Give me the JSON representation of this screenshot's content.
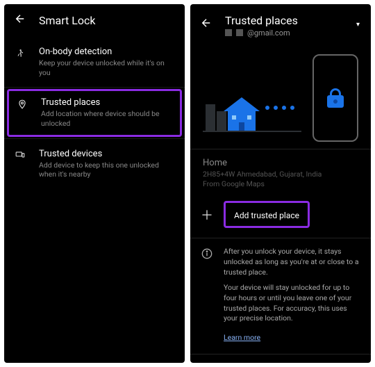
{
  "left": {
    "title": "Smart Lock",
    "items": [
      {
        "title": "On-body detection",
        "subtitle": "Keep your device unlocked while it's on you"
      },
      {
        "title": "Trusted places",
        "subtitle": "Add location where device should be unlocked"
      },
      {
        "title": "Trusted devices",
        "subtitle": "Add device to keep this one unlocked when it's nearby"
      }
    ]
  },
  "right": {
    "title": "Trusted places",
    "account": "@gmail.com",
    "home": {
      "label": "Home",
      "address": "2H85+4W Ahmedabad, Gujarat, India",
      "source": "From Google Maps"
    },
    "add_label": "Add trusted place",
    "info": {
      "p1": "After you unlock your device, it stays unlocked as long as you're at or close to a trusted place.",
      "p2": "Your device will stay unlocked for up to four hours or until you leave one of your trusted places. For accuracy, this uses your precise location.",
      "learn": "Learn more"
    }
  }
}
